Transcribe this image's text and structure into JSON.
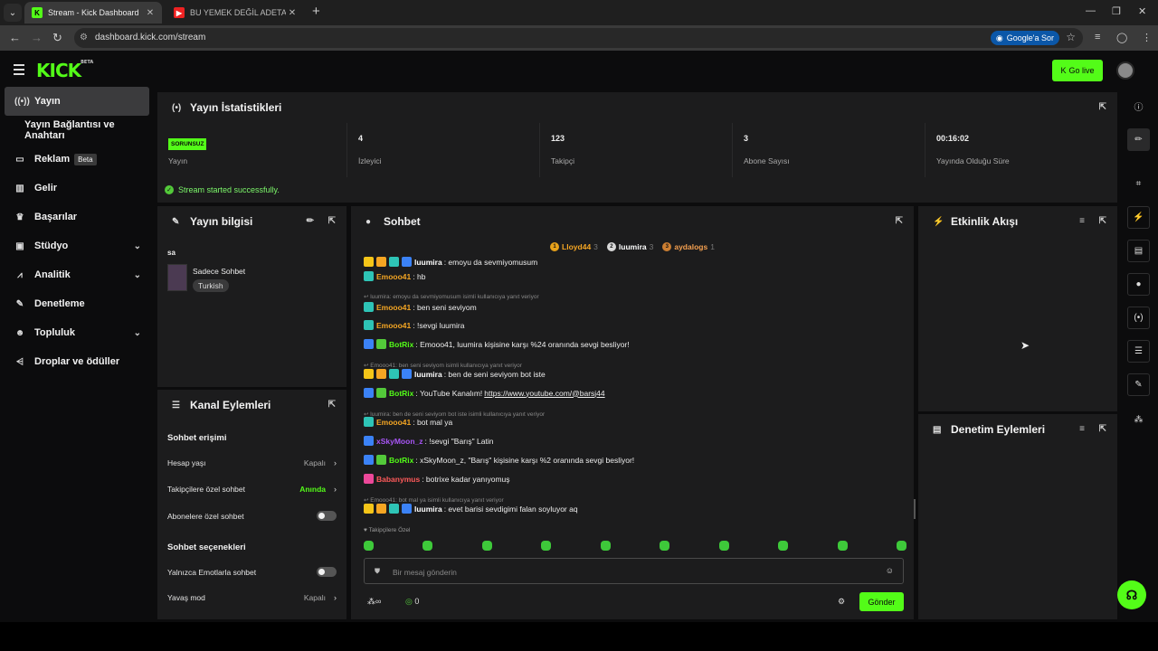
{
  "browser": {
    "tabs": [
      {
        "title": "Stream - Kick Dashboard",
        "active": true
      },
      {
        "title": "BU YEMEK DEĞİL ADETA ŞÖLEN",
        "active": false
      }
    ],
    "url": "dashboard.kick.com/stream",
    "google_btn": "Google'a Sor"
  },
  "header": {
    "logo": "KICK",
    "logo_beta": "BETA",
    "go_live": "Go live"
  },
  "sidebar": {
    "items": [
      {
        "label": "Yayın",
        "icon": "broadcast-icon"
      },
      {
        "label": "Yayın Bağlantısı ve Anahtarı",
        "icon": ""
      },
      {
        "label": "Reklam",
        "icon": "tv-icon",
        "badge": "Beta"
      },
      {
        "label": "Gelir",
        "icon": "chart-icon"
      },
      {
        "label": "Başarılar",
        "icon": "trophy-icon"
      },
      {
        "label": "Stüdyo",
        "icon": "studio-icon"
      },
      {
        "label": "Analitik",
        "icon": "analytics-icon"
      },
      {
        "label": "Denetleme",
        "icon": "wrench-icon"
      },
      {
        "label": "Topluluk",
        "icon": "users-icon"
      },
      {
        "label": "Droplar ve ödüller",
        "icon": "drops-icon"
      }
    ]
  },
  "stats": {
    "title": "Yayın İstatistikleri",
    "status_badge": "SORUNSUZ",
    "items": [
      {
        "value": "",
        "label": "Yayın"
      },
      {
        "value": "4",
        "label": "İzleyici"
      },
      {
        "value": "123",
        "label": "Takipçi"
      },
      {
        "value": "3",
        "label": "Abone Sayısı"
      },
      {
        "value": "00:16:02",
        "label": "Yayında Olduğu Süre"
      }
    ],
    "success_msg": "Stream started successfully."
  },
  "info": {
    "title": "Yayın bilgisi",
    "stream_title": "sa",
    "category": "Sadece Sohbet",
    "tag": "Turkish"
  },
  "channel": {
    "title": "Kanal Eylemleri",
    "sec1": "Sohbet erişimi",
    "account_age": {
      "label": "Hesap yaşı",
      "value": "Kapalı"
    },
    "followers_only": {
      "label": "Takipçilere özel sohbet",
      "value": "Anında"
    },
    "subs_only": {
      "label": "Abonelere özel sohbet"
    },
    "sec2": "Sohbet seçenekleri",
    "emote_only": {
      "label": "Yalnızca Emotlarla sohbet"
    },
    "slow_mode": {
      "label": "Yavaş mod",
      "value": "Kapalı"
    }
  },
  "chat": {
    "title": "Sohbet",
    "leaders": [
      {
        "rank": "1",
        "name": "Lloyd44",
        "count": "3",
        "color": "#f5a623",
        "medal": "#e8a21a"
      },
      {
        "rank": "2",
        "name": "luumira",
        "count": "3",
        "color": "#ffffff",
        "medal": "#d9d9d9"
      },
      {
        "rank": "3",
        "name": "aydalogs",
        "count": "1",
        "color": "#f5a050",
        "medal": "#cd7f32"
      }
    ],
    "messages": [
      {
        "kind": "msg",
        "user": "luumira",
        "color": "#ffffff",
        "text": ": emoyu da sevmiyomusum",
        "badges": [
          "#f5c518",
          "#f5a623",
          "#2ec4b6",
          "#3b82f6"
        ]
      },
      {
        "kind": "msg",
        "user": "Emooo41",
        "color": "#f5a623",
        "text": ": hb",
        "badges": [
          "#2ec4b6"
        ]
      },
      {
        "kind": "reply",
        "text": "luumira: emoyu da sevmiyomusum isimli kullanıcıya yanıt veriyor"
      },
      {
        "kind": "msg",
        "user": "Emooo41",
        "color": "#f5a623",
        "text": ": ben seni seviyom",
        "badges": [
          "#2ec4b6"
        ]
      },
      {
        "kind": "msg",
        "user": "Emooo41",
        "color": "#f5a623",
        "text": ": !sevgi luumira",
        "badges": [
          "#2ec4b6"
        ]
      },
      {
        "kind": "msg",
        "user": "BotRix",
        "color": "#53fc18",
        "text": ": Emooo41, luumira kişisine karşı %24 oranında sevgi besliyor!",
        "badges": [
          "#3b82f6",
          "#53c93a"
        ]
      },
      {
        "kind": "reply",
        "text": "Emooo41: ben seni seviyom isimli kullanıcıya yanıt veriyor"
      },
      {
        "kind": "msg",
        "user": "luumira",
        "color": "#ffffff",
        "text": ": ben de seni seviyom bot iste",
        "badges": [
          "#f5c518",
          "#f5a623",
          "#2ec4b6",
          "#3b82f6"
        ]
      },
      {
        "kind": "msg",
        "user": "BotRix",
        "color": "#53fc18",
        "text": ": YouTube Kanalım! ",
        "link": "https://www.youtube.com/@barsj44",
        "badges": [
          "#3b82f6",
          "#53c93a"
        ]
      },
      {
        "kind": "reply",
        "text": "luumira: ben de seni seviyom bot iste isimli kullanıcıya yanıt veriyor"
      },
      {
        "kind": "msg",
        "user": "Emooo41",
        "color": "#f5a623",
        "text": ": bot mal ya",
        "badges": [
          "#2ec4b6"
        ]
      },
      {
        "kind": "msg",
        "user": "xSkyMoon_z",
        "color": "#a855f7",
        "text": ": !sevgi \"Barış\" Latin",
        "badges": [
          "#3b82f6"
        ]
      },
      {
        "kind": "msg",
        "user": "BotRix",
        "color": "#53fc18",
        "text": ": xSkyMoon_z, \"Barış\" kişisine karşı %2 oranında sevgi besliyor!",
        "badges": [
          "#3b82f6",
          "#53c93a"
        ]
      },
      {
        "kind": "msg",
        "user": "Babanymus",
        "color": "#ff5a5a",
        "text": ": botrixe kadar yanıyomuş",
        "badges": [
          "#ec4899"
        ]
      },
      {
        "kind": "reply",
        "text": "Emooo41: bot mal ya isimli kullanıcıya yanıt veriyor"
      },
      {
        "kind": "msg",
        "user": "luumira",
        "color": "#ffffff",
        "text": ": evet barisi sevdigimi falan soyluyor aq",
        "badges": [
          "#f5c518",
          "#f5a623",
          "#2ec4b6",
          "#3b82f6"
        ]
      }
    ],
    "followers_only_label": "Takipçilere Özel",
    "input_placeholder": "Bir mesaj gönderin",
    "kicks": "0",
    "send": "Gönder"
  },
  "activity": {
    "title": "Etkinlik Akışı"
  },
  "mod_actions": {
    "title": "Denetim Eylemleri"
  }
}
